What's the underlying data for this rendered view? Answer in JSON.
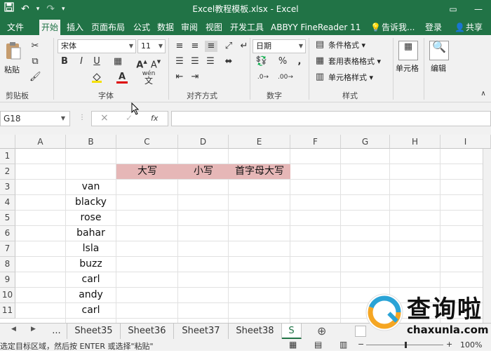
{
  "titlebar": {
    "save_icon": "save-icon",
    "undo_icon": "undo-icon",
    "redo_icon": "redo-icon",
    "title": "Excel教程模板.xlsx - Excel"
  },
  "tabs": [
    "文件",
    "开始",
    "插入",
    "页面布局",
    "公式",
    "数据",
    "审阅",
    "视图",
    "开发工具",
    "ABBYY FineReader 11",
    "告诉我...",
    "登录",
    "共享"
  ],
  "ribbon": {
    "clipboard": {
      "paste": "粘贴",
      "label": "剪贴板"
    },
    "font": {
      "name": "宋体",
      "size": "11",
      "bold": "B",
      "italic": "I",
      "underline": "U",
      "label": "字体",
      "wen": "wén",
      "wen_char": "文"
    },
    "alignment": {
      "label": "对齐方式"
    },
    "number": {
      "format": "日期",
      "percent": "%",
      "comma": ",",
      "label": "数字"
    },
    "styles": {
      "cond": "条件格式",
      "table": "套用表格格式",
      "cell": "单元格样式",
      "label": "样式"
    },
    "cells": {
      "label": "单元格"
    },
    "editing": {
      "label": "编辑"
    }
  },
  "formula_bar": {
    "name_box": "G18",
    "cancel": "×",
    "enter": "✓",
    "fx": "fx",
    "value": ""
  },
  "grid": {
    "columns": [
      "A",
      "B",
      "C",
      "D",
      "E",
      "F",
      "G",
      "H",
      "I"
    ],
    "rows": [
      "1",
      "2",
      "3",
      "4",
      "5",
      "6",
      "7",
      "8",
      "9",
      "10",
      "11"
    ],
    "headers": {
      "C2": "大写",
      "D2": "小写",
      "E2": "首字母大写"
    },
    "names": [
      "van",
      "blacky",
      "rose",
      "bahar",
      "lsla",
      "buzz",
      "carl",
      "andy",
      "carl"
    ]
  },
  "sheets": {
    "nav_ellipsis": "...",
    "tabs": [
      "Sheet35",
      "Sheet36",
      "Sheet37",
      "Sheet38",
      "S"
    ],
    "add": "⊕"
  },
  "status": {
    "text": "选定目标区域，然后按 ENTER 或选择\"粘贴\"",
    "zoom": "100%"
  },
  "watermark": {
    "brand": "查询啦",
    "url": "chaxunla.com"
  },
  "colors": {
    "accent": "#217346",
    "header_fill": "#e6b7b7"
  }
}
